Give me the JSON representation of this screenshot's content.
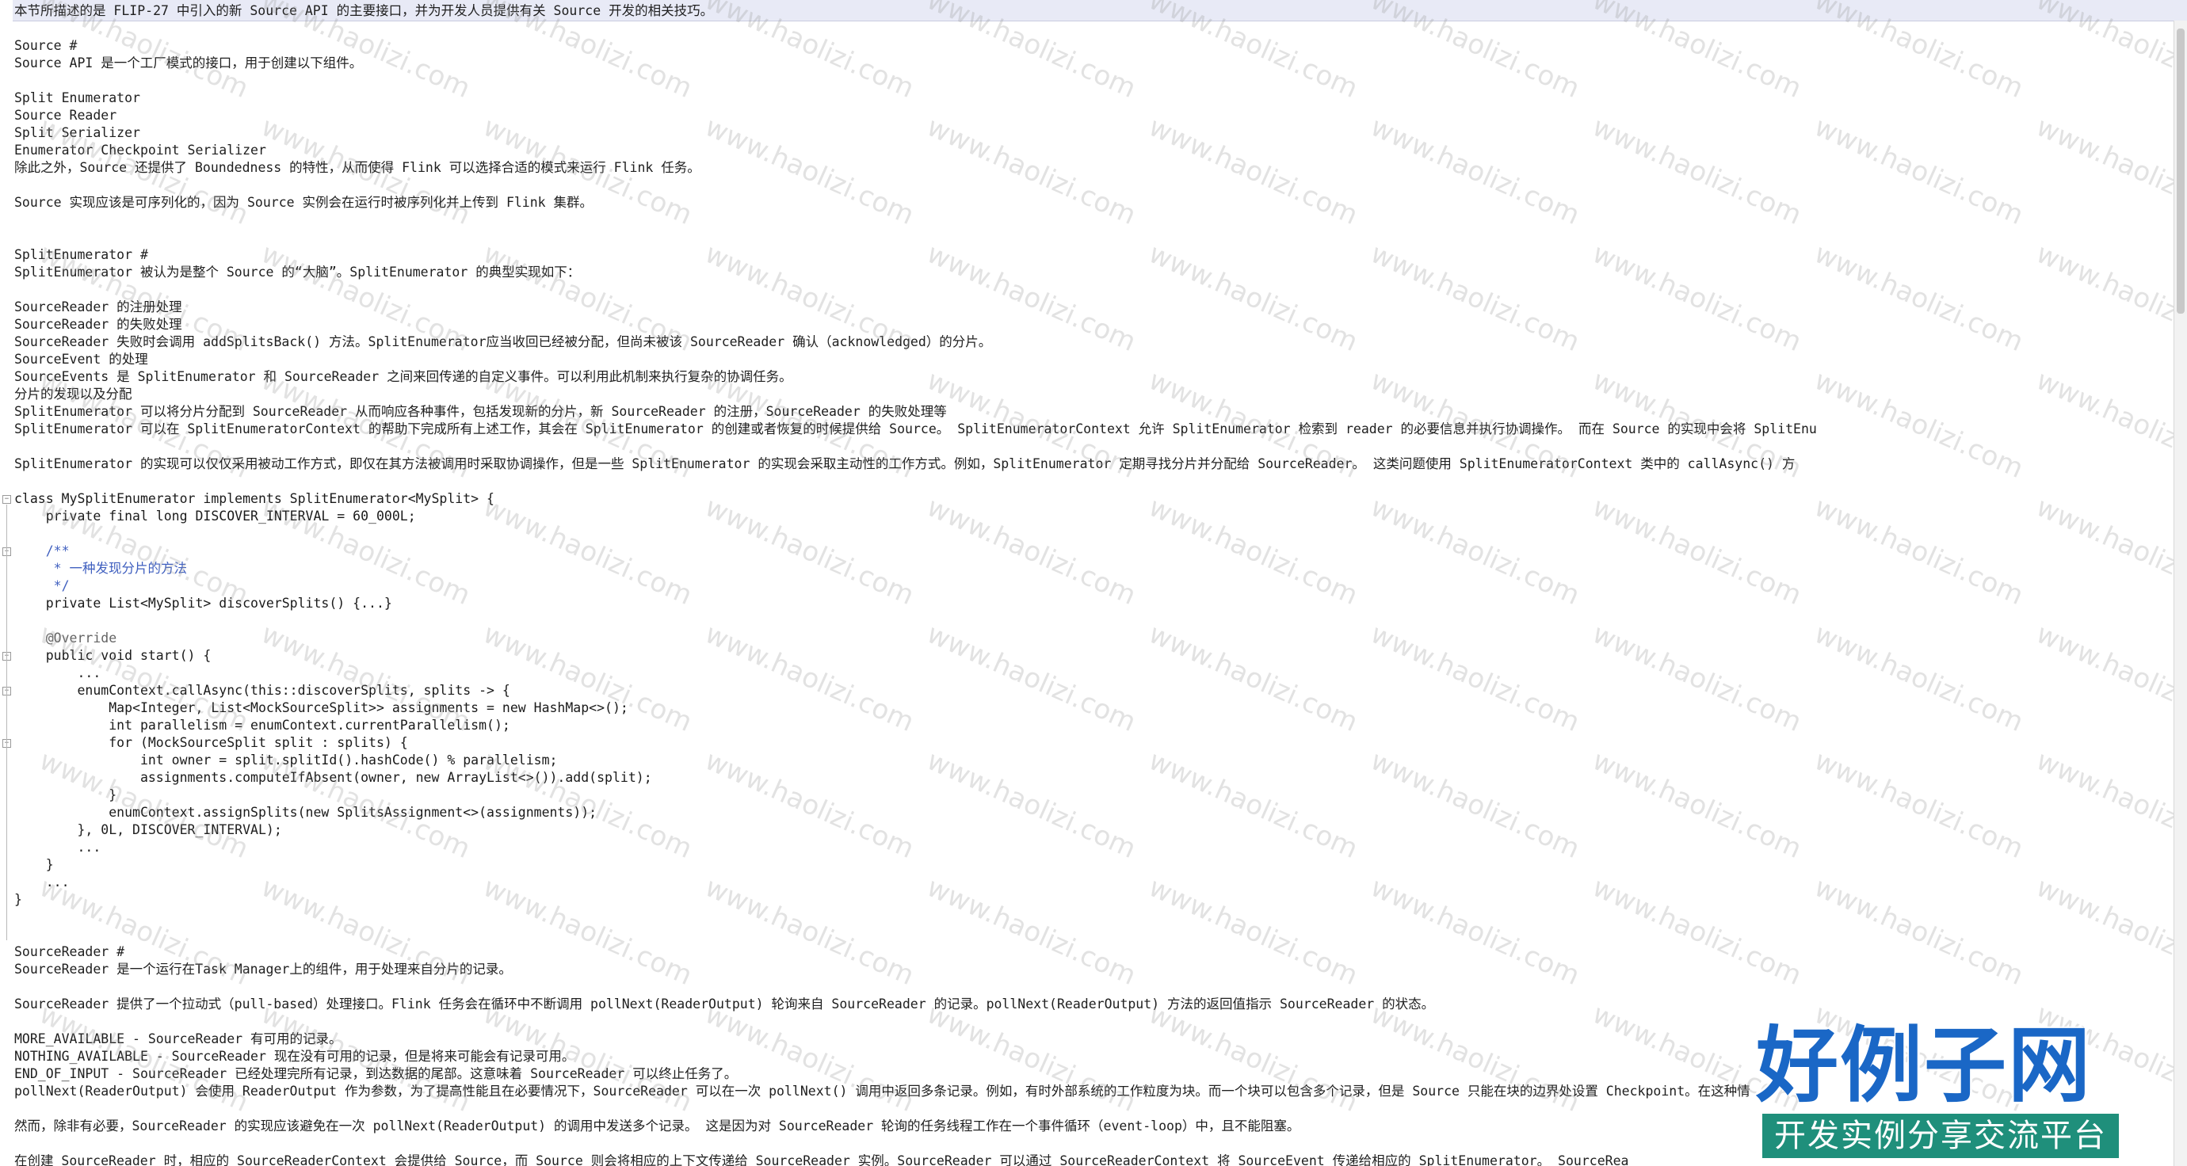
{
  "document": {
    "lines": [
      "本节所描述的是 FLIP-27 中引入的新 Source API 的主要接口，并为开发人员提供有关 Source 开发的相关技巧。",
      "",
      "Source #",
      "Source API 是一个工厂模式的接口，用于创建以下组件。",
      "",
      "Split Enumerator",
      "Source Reader",
      "Split Serializer",
      "Enumerator Checkpoint Serializer",
      "除此之外，Source 还提供了 Boundedness 的特性，从而使得 Flink 可以选择合适的模式来运行 Flink 任务。",
      "",
      "Source 实现应该是可序列化的，因为 Source 实例会在运行时被序列化并上传到 Flink 集群。",
      "",
      "",
      "SplitEnumerator #",
      "SplitEnumerator 被认为是整个 Source 的“大脑”。SplitEnumerator 的典型实现如下：",
      "",
      "SourceReader 的注册处理",
      "SourceReader 的失败处理",
      "SourceReader 失败时会调用 addSplitsBack() 方法。SplitEnumerator应当收回已经被分配，但尚未被该 SourceReader 确认（acknowledged）的分片。",
      "SourceEvent 的处理",
      "SourceEvents 是 SplitEnumerator 和 SourceReader 之间来回传递的自定义事件。可以利用此机制来执行复杂的协调任务。",
      "分片的发现以及分配",
      "SplitEnumerator 可以将分片分配到 SourceReader 从而响应各种事件，包括发现新的分片，新 SourceReader 的注册，SourceReader 的失败处理等",
      "SplitEnumerator 可以在 SplitEnumeratorContext 的帮助下完成所有上述工作，其会在 SplitEnumerator 的创建或者恢复的时候提供给 Source。 SplitEnumeratorContext 允许 SplitEnumerator 检索到 reader 的必要信息并执行协调操作。 而在 Source 的实现中会将 SplitEnu",
      "",
      "SplitEnumerator 的实现可以仅仅采用被动工作方式，即仅在其方法被调用时采取协调操作，但是一些 SplitEnumerator 的实现会采取主动性的工作方式。例如，SplitEnumerator 定期寻找分片并分配给 SourceReader。 这类问题使用 SplitEnumeratorContext 类中的 callAsync() 方",
      "",
      "class MySplitEnumerator implements SplitEnumerator<MySplit> {",
      "    private final long DISCOVER_INTERVAL = 60_000L;",
      "",
      "    /**",
      "     * 一种发现分片的方法",
      "     */",
      "    private List<MySplit> discoverSplits() {...}",
      "",
      "    @Override",
      "    public void start() {",
      "        ...",
      "        enumContext.callAsync(this::discoverSplits, splits -> {",
      "            Map<Integer, List<MockSourceSplit>> assignments = new HashMap<>();",
      "            int parallelism = enumContext.currentParallelism();",
      "            for (MockSourceSplit split : splits) {",
      "                int owner = split.splitId().hashCode() % parallelism;",
      "                assignments.computeIfAbsent(owner, new ArrayList<>()).add(split);",
      "            }",
      "            enumContext.assignSplits(new SplitsAssignment<>(assignments));",
      "        }, 0L, DISCOVER_INTERVAL);",
      "        ...",
      "    }",
      "    ...",
      "}",
      "",
      "",
      "SourceReader #",
      "SourceReader 是一个运行在Task Manager上的组件，用于处理来自分片的记录。",
      "",
      "SourceReader 提供了一个拉动式（pull-based）处理接口。Flink 任务会在循环中不断调用 pollNext(ReaderOutput) 轮询来自 SourceReader 的记录。pollNext(ReaderOutput) 方法的返回值指示 SourceReader 的状态。",
      "",
      "MORE_AVAILABLE - SourceReader 有可用的记录。",
      "NOTHING_AVAILABLE - SourceReader 现在没有可用的记录，但是将来可能会有记录可用。",
      "END_OF_INPUT - SourceReader 已经处理完所有记录，到达数据的尾部。这意味着 SourceReader 可以终止任务了。",
      "pollNext(ReaderOutput) 会使用 ReaderOutput 作为参数，为了提高性能且在必要情况下，SourceReader 可以在一次 pollNext() 调用中返回多条记录。例如，有时外部系统的工作粒度为块。而一个块可以包含多个记录，但是 Source 只能在块的边界处设置 Checkpoint。在这种情",
      "",
      "然而，除非有必要，SourceReader 的实现应该避免在一次 pollNext(ReaderOutput) 的调用中发送多个记录。 这是因为对 SourceReader 轮询的任务线程工作在一个事件循环（event-loop）中，且不能阻塞。",
      "",
      "在创建 SourceReader 时，相应的 SourceReaderContext 会提供给 Source，而 Source 则会将相应的上下文传递给 SourceReader 实例。SourceReader 可以通过 SourceReaderContext 将 SourceEvent 传递给相应的 SplitEnumerator。 SourceRea"
    ]
  },
  "watermark": {
    "text": "www.haolizi.com"
  },
  "logo": {
    "main": "好例子网",
    "sub": "开发实例分享交流平台"
  }
}
